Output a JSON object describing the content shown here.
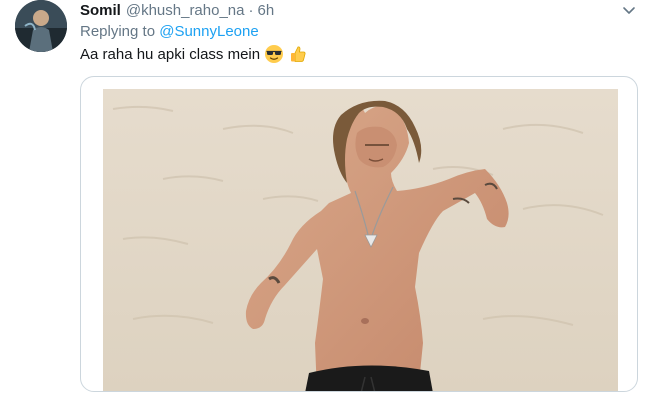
{
  "tweet": {
    "display_name": "Somil",
    "handle": "@khush_raho_na",
    "separator": "·",
    "time": "6h",
    "reply_prefix": "Replying to",
    "reply_to": "@SunnyLeone",
    "text": "Aa raha hu apki class mein",
    "emojis": [
      "sunglasses-face-emoji",
      "thumbs-up-emoji"
    ]
  },
  "icons": {
    "menu": "chevron-down-icon"
  },
  "colors": {
    "link": "#1da1f2",
    "secondary_text": "#657786",
    "primary_text": "#14171a",
    "border": "#ccd6dd"
  }
}
